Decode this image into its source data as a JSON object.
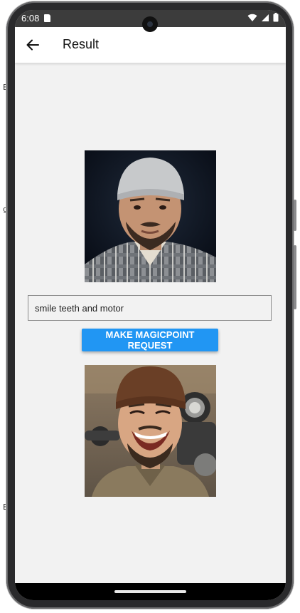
{
  "edge_glyphs": [
    "B",
    "g",
    "E"
  ],
  "status_bar": {
    "time": "6:08",
    "icons": [
      "sd-card-icon",
      "wifi-icon",
      "signal-icon",
      "battery-icon"
    ]
  },
  "app_bar": {
    "back_icon": "arrow-left-icon",
    "title": "Result"
  },
  "source_image": {
    "description_icon": "portrait-photo"
  },
  "prompt": {
    "value": "smile teeth and motor",
    "placeholder": ""
  },
  "request_button": {
    "label": "MAKE MAGICPOINT REQUEST"
  },
  "result_image": {
    "description_icon": "portrait-photo"
  },
  "colors": {
    "accent": "#2196f3",
    "background": "#f2f2f2",
    "status_bar": "#3c3c3c",
    "app_bar": "#ffffff"
  }
}
